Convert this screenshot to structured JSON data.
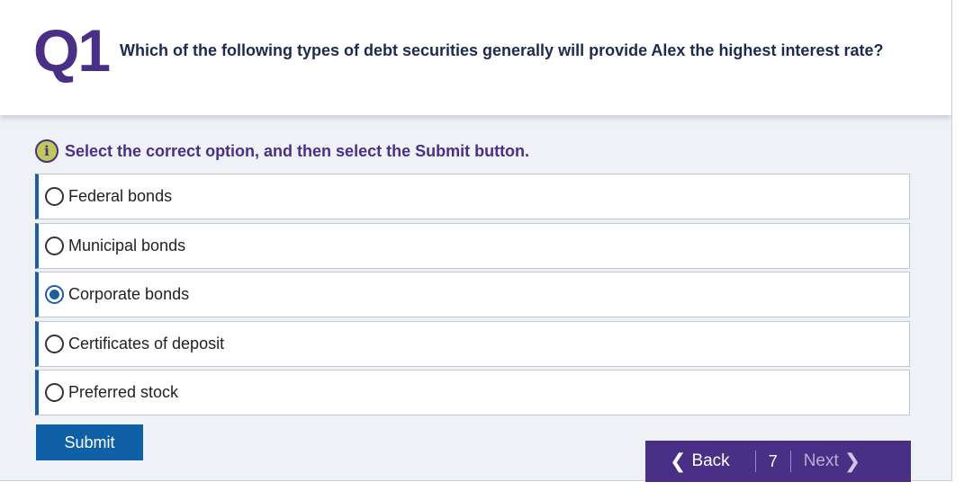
{
  "header": {
    "question_number": "Q1",
    "question_text": "Which of the following types of debt securities generally will provide Alex the highest interest rate?"
  },
  "instruction": {
    "icon": "info-icon",
    "text": "Select the correct option, and then select the Submit button."
  },
  "options": [
    {
      "label": "Federal bonds",
      "selected": false
    },
    {
      "label": "Municipal bonds",
      "selected": false
    },
    {
      "label": "Corporate bonds",
      "selected": true
    },
    {
      "label": "Certificates of deposit",
      "selected": false
    },
    {
      "label": "Preferred stock",
      "selected": false
    }
  ],
  "submit_label": "Submit",
  "nav": {
    "back_label": "Back",
    "page_number": "7",
    "next_label": "Next"
  },
  "colors": {
    "brand_purple": "#4a2f86",
    "accent_blue": "#1060a8",
    "info_icon_fill": "#bfc85a"
  }
}
